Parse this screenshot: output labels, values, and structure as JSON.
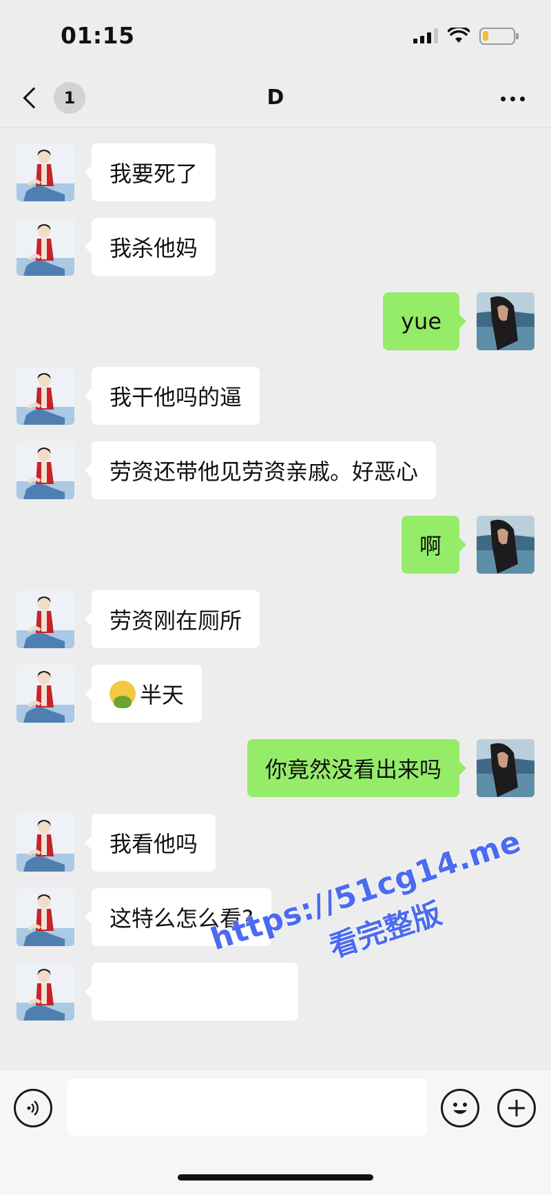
{
  "status_bar": {
    "time": "01:15",
    "battery_level": 0.2,
    "battery_color": "#f2c233"
  },
  "nav": {
    "back_icon": "chevron-left-icon",
    "unread_count": "1",
    "title": "D",
    "more_icon": "ellipsis-icon"
  },
  "colors": {
    "background": "#ededed",
    "incoming_bubble": "#ffffff",
    "outgoing_bubble": "#95ec69"
  },
  "messages": [
    {
      "side": "in",
      "text": "我要死了"
    },
    {
      "side": "in",
      "text": "我杀他妈"
    },
    {
      "side": "out",
      "text": "yue"
    },
    {
      "side": "in",
      "text": "我干他吗的逼"
    },
    {
      "side": "in",
      "text": "劳资还带他见劳资亲戚。好恶心"
    },
    {
      "side": "out",
      "text": "啊"
    },
    {
      "side": "in",
      "text": "劳资刚在厕所"
    },
    {
      "side": "in",
      "text": "半天",
      "emoji": "nauseated-face-emoji"
    },
    {
      "side": "out",
      "text": "你竟然没看出来吗"
    },
    {
      "side": "in",
      "text": "我看他吗"
    },
    {
      "side": "in",
      "text": "这特么怎么看?"
    }
  ],
  "input_bar": {
    "voice_icon": "voice-icon",
    "emoji_icon": "smiley-icon",
    "plus_icon": "plus-icon",
    "text_value": ""
  },
  "watermark": {
    "url": "https://51cg14.me",
    "subtitle": "看完整版"
  }
}
